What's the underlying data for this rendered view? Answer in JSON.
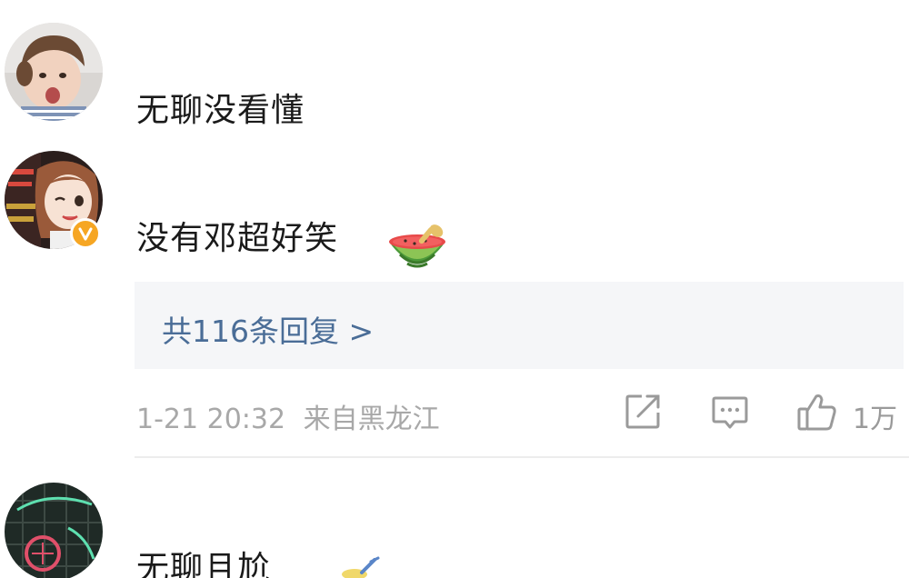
{
  "comments": [
    {
      "text": "无聊没看懂",
      "avatar_icon": "toddler-avatar"
    },
    {
      "text": "没有邓超好笑",
      "avatar_icon": "cartoon-girl-avatar",
      "verified": true,
      "emoji_icon": "watermelon-emoji",
      "replies_label": "共116条回复 >",
      "timestamp": "1-21 20:32",
      "location": "来自黑龙江",
      "like_count": "1万",
      "actions": [
        "share-icon",
        "comment-icon",
        "like-icon"
      ]
    },
    {
      "text": "无聊且尬",
      "avatar_icon": "neon-sign-avatar"
    }
  ],
  "colors": {
    "reply_link": "#4a6d97",
    "reply_box_bg": "#f5f6f8",
    "meta_text": "#a8a8a8",
    "verified_badge": "#f6a623"
  }
}
